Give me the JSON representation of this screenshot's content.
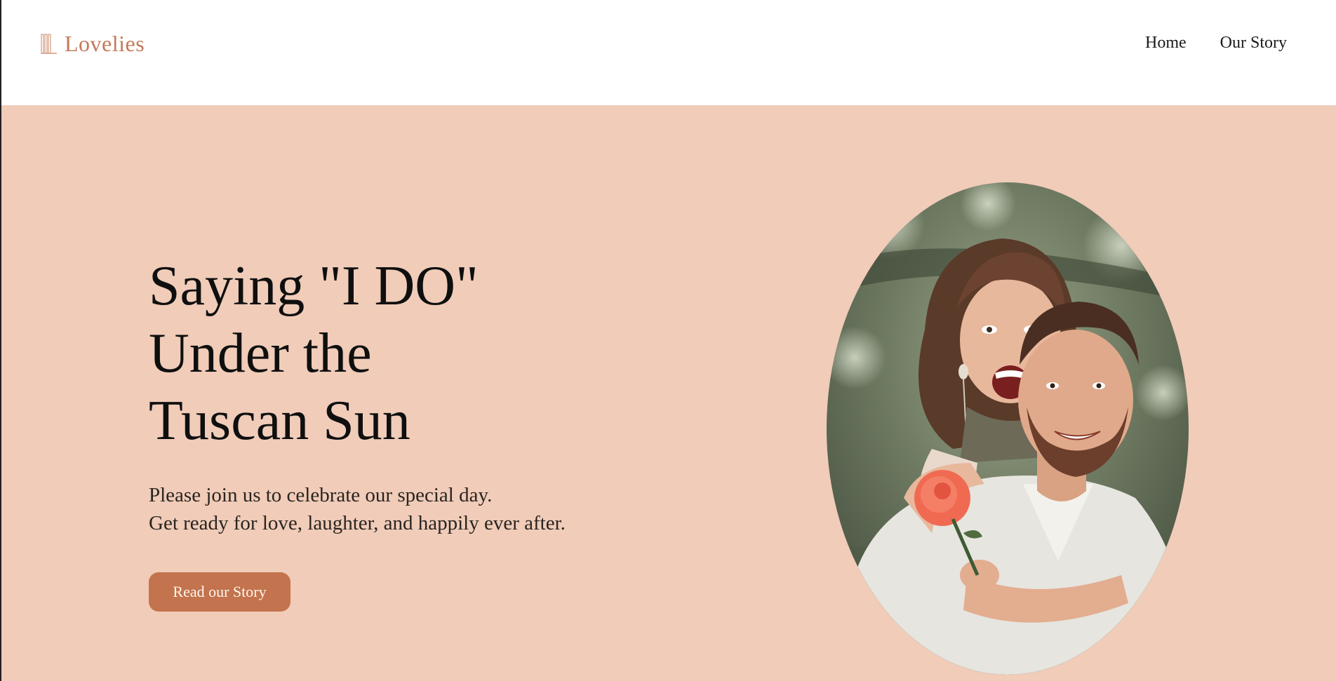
{
  "header": {
    "logo_text": "Lovelies",
    "logo_icon": "triple-l-monogram-icon",
    "nav": [
      {
        "label": "Home"
      },
      {
        "label": "Our Story"
      }
    ]
  },
  "hero": {
    "title_lines": [
      "Saying \"I DO\"",
      "Under the",
      "Tuscan Sun"
    ],
    "subtitle_lines": [
      "Please join us to celebrate our special day.",
      "Get ready for love, laughter, and happily ever after."
    ],
    "cta_label": "Read our Story",
    "photo_icon": "couple-photo"
  },
  "colors": {
    "accent": "#c3734d",
    "logo": "#c4795a",
    "hero_background": "#f0ccb9",
    "header_background": "#ffffff",
    "text": "#0f0f0f"
  }
}
